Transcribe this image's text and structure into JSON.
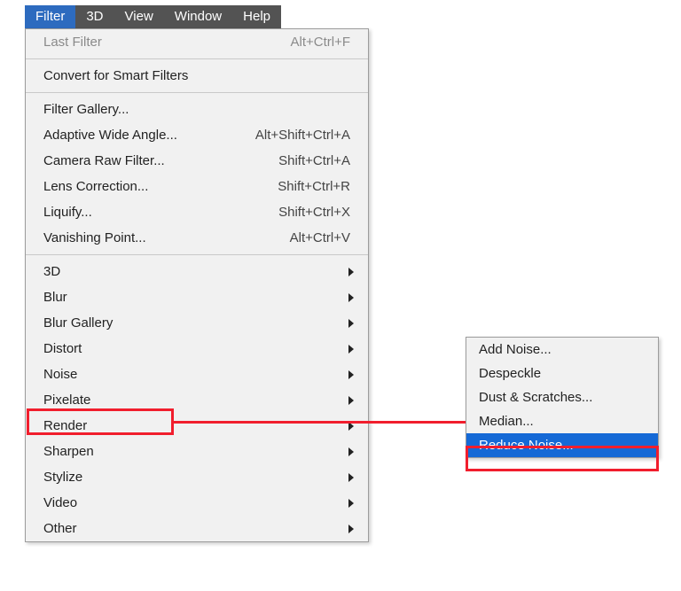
{
  "menubar": [
    {
      "label": "Filter",
      "active": true
    },
    {
      "label": "3D"
    },
    {
      "label": "View"
    },
    {
      "label": "Window"
    },
    {
      "label": "Help"
    }
  ],
  "main": {
    "group1": [
      {
        "label": "Last Filter",
        "shortcut": "Alt+Ctrl+F",
        "disabled": true
      }
    ],
    "group2": [
      {
        "label": "Convert for Smart Filters"
      }
    ],
    "group3": [
      {
        "label": "Filter Gallery..."
      },
      {
        "label": "Adaptive Wide Angle...",
        "shortcut": "Alt+Shift+Ctrl+A"
      },
      {
        "label": "Camera Raw Filter...",
        "shortcut": "Shift+Ctrl+A"
      },
      {
        "label": "Lens Correction...",
        "shortcut": "Shift+Ctrl+R"
      },
      {
        "label": "Liquify...",
        "shortcut": "Shift+Ctrl+X"
      },
      {
        "label": "Vanishing Point...",
        "shortcut": "Alt+Ctrl+V"
      }
    ],
    "group4": [
      {
        "label": "3D",
        "submenu": true
      },
      {
        "label": "Blur",
        "submenu": true
      },
      {
        "label": "Blur Gallery",
        "submenu": true
      },
      {
        "label": "Distort",
        "submenu": true
      },
      {
        "label": "Noise",
        "submenu": true,
        "boxed": true
      },
      {
        "label": "Pixelate",
        "submenu": true
      },
      {
        "label": "Render",
        "submenu": true
      },
      {
        "label": "Sharpen",
        "submenu": true
      },
      {
        "label": "Stylize",
        "submenu": true
      },
      {
        "label": "Video",
        "submenu": true
      },
      {
        "label": "Other",
        "submenu": true
      }
    ]
  },
  "submenu": [
    {
      "label": "Add Noise..."
    },
    {
      "label": "Despeckle"
    },
    {
      "label": "Dust & Scratches..."
    },
    {
      "label": "Median..."
    },
    {
      "label": "Reduce Noise...",
      "highlight": true,
      "boxed": true
    }
  ]
}
